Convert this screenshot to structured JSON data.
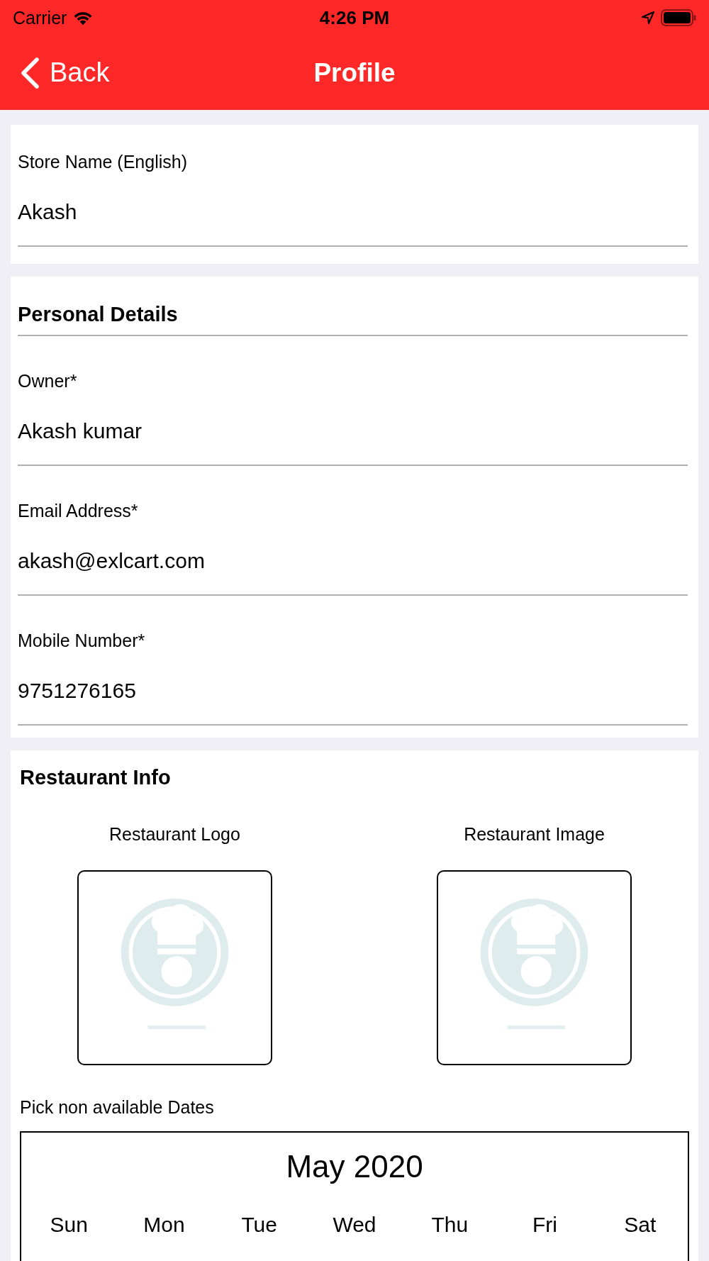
{
  "status_bar": {
    "carrier": "Carrier",
    "time": "4:26 PM"
  },
  "nav": {
    "back": "Back",
    "title": "Profile"
  },
  "store_card": {
    "fields": [
      {
        "label": "Store Name (English)",
        "value": "Akash"
      }
    ]
  },
  "personal_details": {
    "heading": "Personal Details",
    "fields": [
      {
        "label": "Owner*",
        "value": "Akash kumar"
      },
      {
        "label": "Email Address*",
        "value": "akash@exlcart.com"
      },
      {
        "label": "Mobile Number*",
        "value": "9751276165"
      }
    ]
  },
  "restaurant_info": {
    "heading": "Restaurant Info",
    "images": [
      {
        "label": "Restaurant Logo",
        "kind": "picture"
      },
      {
        "label": "Restaurant Image",
        "kind": "picture"
      }
    ],
    "dates_label": "Pick non available Dates",
    "calendar": {
      "month": "May 2020",
      "weekdays": [
        "Sun",
        "Mon",
        "Tue",
        "Wed",
        "Thu",
        "Fri",
        "Sat"
      ]
    }
  }
}
